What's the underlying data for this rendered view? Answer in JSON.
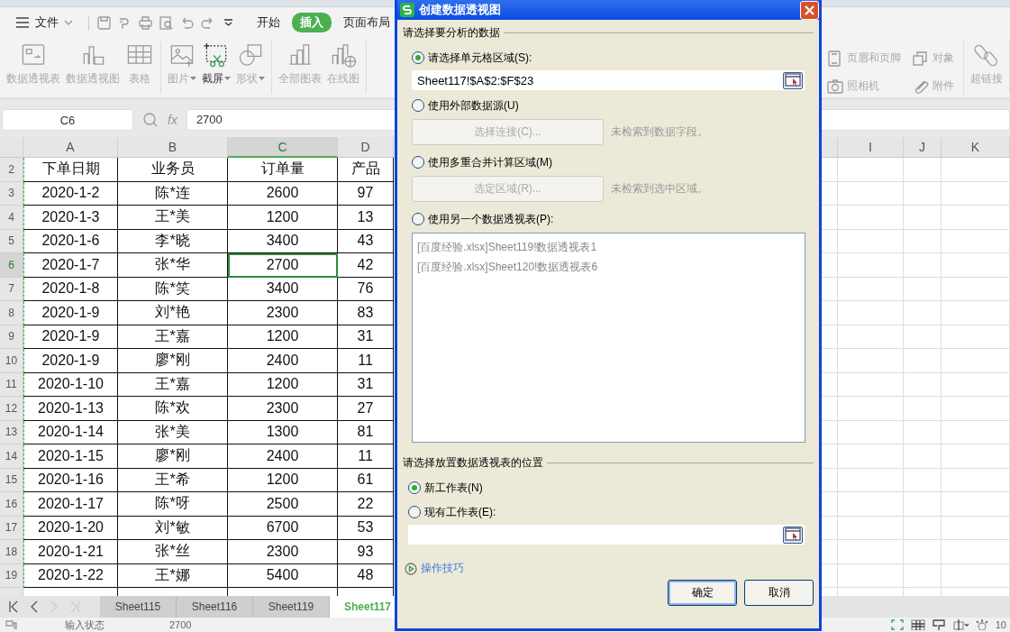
{
  "menu_bar": {
    "file_menu": "文件",
    "tabs": [
      {
        "label": "开始",
        "selected": false
      },
      {
        "label": "插入",
        "selected": true
      },
      {
        "label": "页面布局",
        "selected": false
      }
    ]
  },
  "ribbon": {
    "groups": [
      {
        "items": [
          {
            "label": "数据透视表",
            "disabled": true,
            "dropdown": false
          },
          {
            "label": "数据透视图",
            "disabled": true,
            "dropdown": false
          },
          {
            "label": "表格",
            "disabled": true,
            "dropdown": false
          }
        ]
      },
      {
        "items": [
          {
            "label": "图片",
            "disabled": true,
            "dropdown": true
          },
          {
            "label": "截屏",
            "disabled": false,
            "dropdown": true
          },
          {
            "label": "形状",
            "disabled": true,
            "dropdown": true
          }
        ]
      },
      {
        "items": [
          {
            "label": "全部图表",
            "disabled": true,
            "dropdown": false
          },
          {
            "label": "在线图",
            "disabled": true,
            "dropdown": false
          }
        ]
      }
    ],
    "right_small": [
      {
        "label": "页眉和页脚"
      },
      {
        "label": "对象"
      },
      {
        "label": "照相机"
      },
      {
        "label": "附件"
      }
    ],
    "right_large": {
      "label": "超链接"
    }
  },
  "formula_bar": {
    "name_box": "C6",
    "fx": "fx",
    "value": "2700"
  },
  "table": {
    "columns_left": [
      {
        "label": "A",
        "selected": false
      },
      {
        "label": "B",
        "selected": false
      },
      {
        "label": "C",
        "selected": true
      },
      {
        "label": "D",
        "selected": false
      }
    ],
    "columns_right": [
      {
        "label": "I",
        "selected": false
      },
      {
        "label": "J",
        "selected": false
      },
      {
        "label": "K",
        "selected": false
      }
    ],
    "rows": [
      {
        "number": "2",
        "selected": false,
        "cells": [
          "下单日期",
          "业务员",
          "订单量",
          "产品"
        ]
      },
      {
        "number": "3",
        "selected": false,
        "cells": [
          "2020-1-2",
          "陈*连",
          "2600",
          "97"
        ]
      },
      {
        "number": "4",
        "selected": false,
        "cells": [
          "2020-1-3",
          "王*美",
          "1200",
          "13"
        ]
      },
      {
        "number": "5",
        "selected": false,
        "cells": [
          "2020-1-6",
          "李*晓",
          "3400",
          "43"
        ]
      },
      {
        "number": "6",
        "selected": true,
        "cells": [
          "2020-1-7",
          "张*华",
          "2700",
          "42"
        ]
      },
      {
        "number": "7",
        "selected": false,
        "cells": [
          "2020-1-8",
          "陈*笑",
          "3400",
          "76"
        ]
      },
      {
        "number": "8",
        "selected": false,
        "cells": [
          "2020-1-9",
          "刘*艳",
          "2300",
          "83"
        ]
      },
      {
        "number": "9",
        "selected": false,
        "cells": [
          "2020-1-9",
          "王*嘉",
          "1200",
          "31"
        ]
      },
      {
        "number": "10",
        "selected": false,
        "cells": [
          "2020-1-9",
          "廖*刚",
          "2400",
          "11"
        ]
      },
      {
        "number": "11",
        "selected": false,
        "cells": [
          "2020-1-10",
          "王*嘉",
          "1200",
          "31"
        ]
      },
      {
        "number": "12",
        "selected": false,
        "cells": [
          "2020-1-13",
          "陈*欢",
          "2300",
          "27"
        ]
      },
      {
        "number": "13",
        "selected": false,
        "cells": [
          "2020-1-14",
          "张*美",
          "1300",
          "81"
        ]
      },
      {
        "number": "14",
        "selected": false,
        "cells": [
          "2020-1-15",
          "廖*刚",
          "2400",
          "11"
        ]
      },
      {
        "number": "15",
        "selected": false,
        "cells": [
          "2020-1-16",
          "王*希",
          "1200",
          "61"
        ]
      },
      {
        "number": "16",
        "selected": false,
        "cells": [
          "2020-1-17",
          "陈*呀",
          "2500",
          "22"
        ]
      },
      {
        "number": "17",
        "selected": false,
        "cells": [
          "2020-1-20",
          "刘*敏",
          "6700",
          "53"
        ]
      },
      {
        "number": "18",
        "selected": false,
        "cells": [
          "2020-1-21",
          "张*丝",
          "2300",
          "93"
        ]
      },
      {
        "number": "19",
        "selected": false,
        "cells": [
          "2020-1-22",
          "王*娜",
          "5400",
          "48"
        ]
      }
    ]
  },
  "sheet_tabs": [
    {
      "label": "Sheet115",
      "selected": false
    },
    {
      "label": "Sheet116",
      "selected": false
    },
    {
      "label": "Sheet119",
      "selected": false
    },
    {
      "label": "Sheet117",
      "selected": true
    }
  ],
  "status_bar": {
    "mode": "输入状态",
    "value": "2700",
    "zoom": "10"
  },
  "dialog": {
    "title": "创建数据透视图",
    "source": {
      "heading": "请选择要分析的数据",
      "options": [
        {
          "kind": "range",
          "label": "请选择单元格区域(S):",
          "selected": true,
          "value": "Sheet117!$A$2:$F$23"
        },
        {
          "kind": "button",
          "label": "使用外部数据源(U)",
          "selected": false,
          "button": "选择连接(C)...",
          "disabled": true,
          "note": "未检索到数据字段。"
        },
        {
          "kind": "button",
          "label": "使用多重合并计算区域(M)",
          "selected": false,
          "button": "选定区域(R)...",
          "disabled": true,
          "note": "未检索到选中区域。"
        },
        {
          "kind": "list",
          "label": "使用另一个数据透视表(P):",
          "selected": false,
          "disabled": true,
          "items": [
            "[百度经验.xlsx]Sheet119!数据透视表1",
            "[百度经验.xlsx]Sheet120!数据透视表6"
          ]
        }
      ]
    },
    "location": {
      "heading": "请选择放置数据透视表的位置",
      "options": [
        {
          "kind": "plain",
          "label": "新工作表(N)",
          "selected": true
        },
        {
          "kind": "range",
          "label": "现有工作表(E):",
          "selected": false
        }
      ]
    },
    "tips_link": "操作技巧",
    "buttons": [
      {
        "label": "确定",
        "default": true
      },
      {
        "label": "取消",
        "default": false
      }
    ]
  }
}
